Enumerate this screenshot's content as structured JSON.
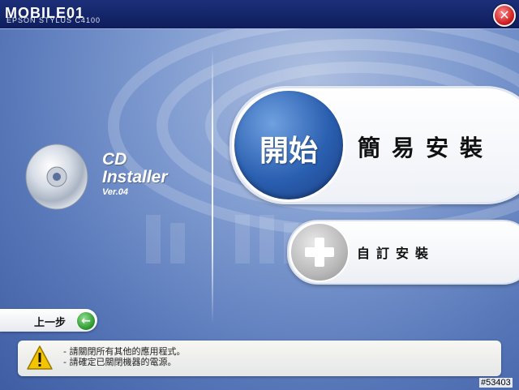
{
  "window": {
    "title": "MOBILE01",
    "subtitle": "EPSON STYLUS C4100",
    "close_icon": "close-icon"
  },
  "installer": {
    "title_line1": "CD",
    "title_line2": "Installer",
    "version": "Ver.04",
    "disc_icon": "cd-disc-icon"
  },
  "easy_install": {
    "badge": "開始",
    "label": "簡易安裝"
  },
  "custom_install": {
    "icon": "plus-icon",
    "label": "自訂安裝"
  },
  "back": {
    "label": "上一步",
    "icon": "back-arrow-icon"
  },
  "notice": {
    "icon": "warning-icon",
    "lines": [
      "請關閉所有其他的應用程式。",
      "請確定已關閉機器的電源。"
    ]
  },
  "image_id": "#53403",
  "colors": {
    "title_bar": "#14256a",
    "accent_blue": "#2a5fb0",
    "back_green": "#2f9a2f",
    "close_red": "#c81616",
    "warning_yellow": "#f5c400"
  }
}
